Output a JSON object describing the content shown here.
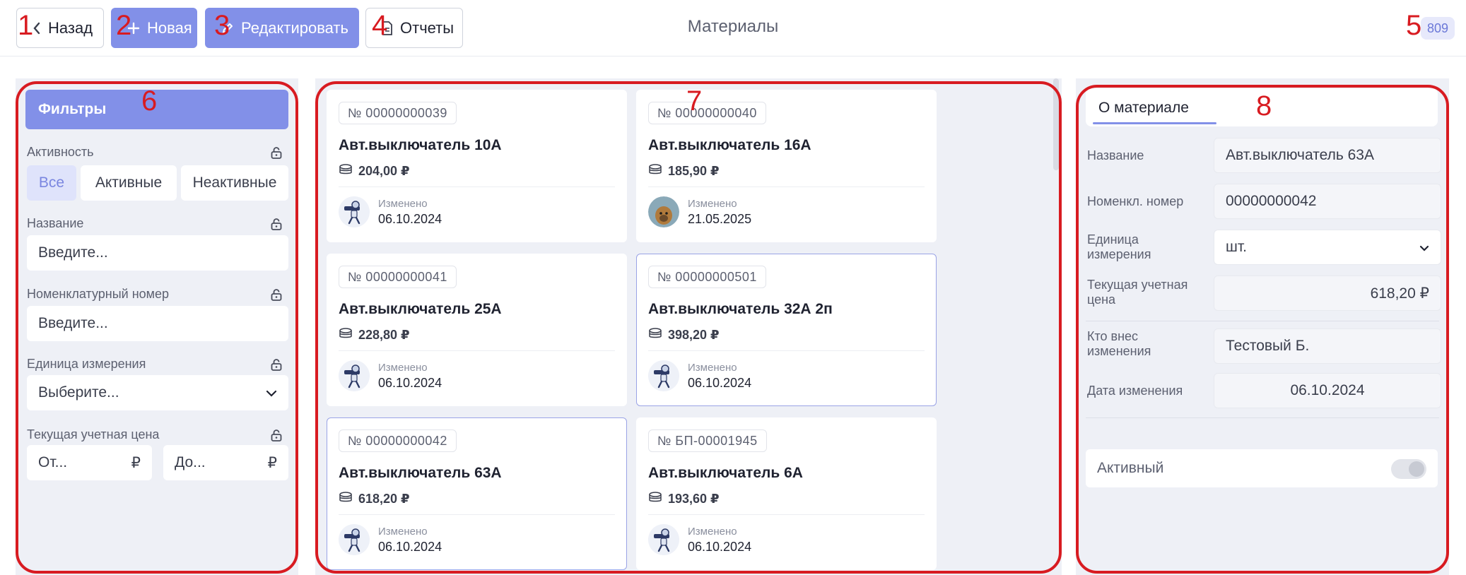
{
  "toolbar": {
    "back_label": "Назад",
    "new_label": "Новая",
    "edit_label": "Редактировать",
    "reports_label": "Отчеты"
  },
  "page_title": "Материалы",
  "count_badge": "809",
  "filters": {
    "title": "Фильтры",
    "activity_label": "Активность",
    "activity_options": [
      "Все",
      "Активные",
      "Неактивные"
    ],
    "activity_selected": "Все",
    "name_label": "Название",
    "name_placeholder": "Введите...",
    "nomen_label": "Номенклатурный номер",
    "nomen_placeholder": "Введите...",
    "unit_label": "Единица измерения",
    "unit_placeholder": "Выберите...",
    "price_label": "Текущая учетная цена",
    "price_from_placeholder": "От...",
    "price_to_placeholder": "До...",
    "currency": "₽"
  },
  "cards": [
    {
      "number": "№ 00000000039",
      "name": "Авт.выключатель 10А",
      "price": "204,00 ₽",
      "changed_label": "Изменено",
      "changed_date": "06.10.2024",
      "avatar": "robot",
      "selected": false
    },
    {
      "number": "№ 00000000040",
      "name": "Авт.выключатель 16А",
      "price": "185,90 ₽",
      "changed_label": "Изменено",
      "changed_date": "21.05.2025",
      "avatar": "photo",
      "selected": false
    },
    {
      "number": "№ 00000000041",
      "name": "Авт.выключатель 25А",
      "price": "228,80 ₽",
      "changed_label": "Изменено",
      "changed_date": "06.10.2024",
      "avatar": "robot",
      "selected": false
    },
    {
      "number": "№ 00000000501",
      "name": "Авт.выключатель 32А 2п",
      "price": "398,20 ₽",
      "changed_label": "Изменено",
      "changed_date": "06.10.2024",
      "avatar": "robot",
      "selected": true
    },
    {
      "number": "№ 00000000042",
      "name": "Авт.выключатель 63А",
      "price": "618,20 ₽",
      "changed_label": "Изменено",
      "changed_date": "06.10.2024",
      "avatar": "robot",
      "selected": true
    },
    {
      "number": "№ БП-00001945",
      "name": "Авт.выключатель 6А",
      "price": "193,60 ₽",
      "changed_label": "Изменено",
      "changed_date": "06.10.2024",
      "avatar": "robot",
      "selected": false
    }
  ],
  "details": {
    "tab_label": "О материале",
    "name_label": "Название",
    "name_value": "Авт.выключатель 63А",
    "nomen_label": "Номенкл. номер",
    "nomen_value": "00000000042",
    "unit_label": "Единица измерения",
    "unit_value": "шт.",
    "price_label": "Текущая учетная цена",
    "price_value": "618,20 ₽",
    "changed_by_label": "Кто внес изменения",
    "changed_by_value": "Тестовый Б.",
    "changed_date_label": "Дата изменения",
    "changed_date_value": "06.10.2024",
    "active_label": "Активный",
    "active_value": false
  },
  "annotations": [
    "1",
    "2",
    "3",
    "4",
    "5",
    "6",
    "7",
    "8"
  ],
  "colors": {
    "accent": "#8290e8",
    "panel_bg": "#eef0f6",
    "annotation_red": "#d81b21"
  }
}
